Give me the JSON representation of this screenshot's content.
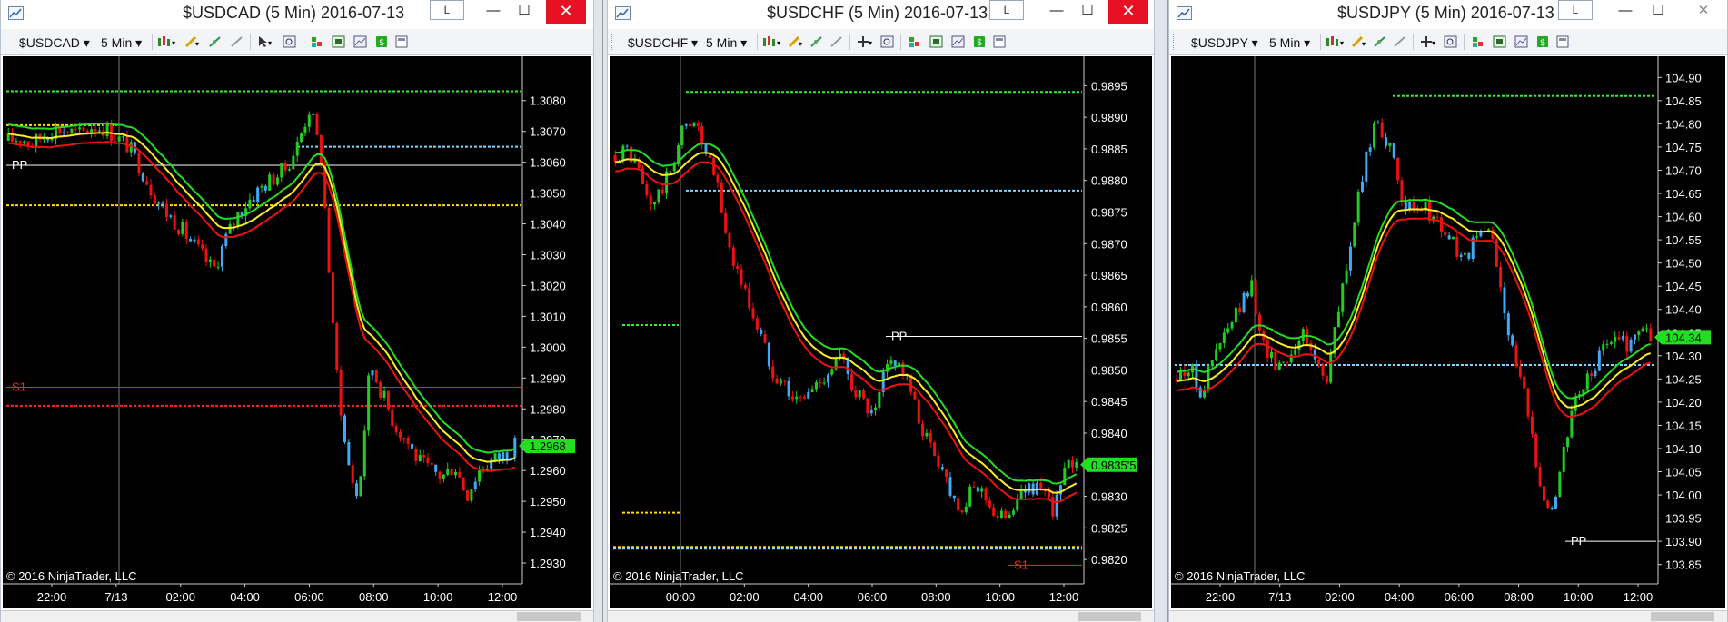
{
  "colors": {
    "background": "#000000",
    "up_candle": "#22cc22",
    "down_candle": "#ee1111",
    "neutral_candle": "#3fa9f5",
    "band_outer": "#22dd22",
    "band_mid": "#ffee22",
    "band_inner": "#ee1111",
    "level_pp": "#ffffff",
    "level_green": "#33ee33",
    "level_yellow": "#ffdd00",
    "level_cyan": "#7fd4ff",
    "level_red": "#ff2222",
    "price_label_bg": "#22dd22"
  },
  "windows": [
    {
      "title": "$USDCAD (5 Min)  2016-07-13",
      "tag": "L",
      "toolbar": {
        "instrument": "$USDCAD",
        "interval": "5 Min"
      },
      "copyright": "© 2016 NinjaTrader, LLC",
      "chart_data": {
        "type": "candlestick",
        "ylim": [
          1.2925,
          1.3092
        ],
        "y_ticks": [
          "1.3080",
          "1.3070",
          "1.3060",
          "1.3050",
          "1.3040",
          "1.3030",
          "1.3020",
          "1.3010",
          "1.3000",
          "1.2990",
          "1.2980",
          "1.2970",
          "1.2960",
          "1.2950",
          "1.2940",
          "1.2930"
        ],
        "x_ticks": [
          "22:00",
          "7/13",
          "02:00",
          "04:00",
          "06:00",
          "08:00",
          "10:00",
          "12:00"
        ],
        "last_price": "1.2968",
        "levels": [
          {
            "label": "PP",
            "value": 1.3059,
            "color": "level_pp"
          },
          {
            "label": "S1",
            "value": 1.2987,
            "color": "level_red"
          },
          {
            "label": "",
            "value": 1.3083,
            "color": "level_green"
          },
          {
            "label": "",
            "value": 1.3072,
            "color": "level_yellow"
          },
          {
            "label": "",
            "value": 1.3065,
            "color": "level_cyan"
          },
          {
            "label": "",
            "value": 1.3046,
            "color": "level_yellow"
          },
          {
            "label": "",
            "value": 1.2981,
            "color": "level_red"
          }
        ],
        "path": [
          1.3067,
          1.3068,
          1.3066,
          1.3069,
          1.3071,
          1.307,
          1.3069,
          1.3072,
          1.3071,
          1.3068,
          1.3065,
          1.3058,
          1.305,
          1.3044,
          1.304,
          1.3035,
          1.303,
          1.3025,
          1.3035,
          1.3043,
          1.3048,
          1.3052,
          1.3055,
          1.3058,
          1.3066,
          1.3078,
          1.306,
          1.3,
          1.2965,
          1.295,
          1.2995,
          1.2985,
          1.2975,
          1.297,
          1.2963,
          1.296,
          1.2958,
          1.2962,
          1.2952,
          1.296,
          1.2963,
          1.2965,
          1.2968
        ]
      }
    },
    {
      "title": "$USDCHF (5 Min)  2016-07-13",
      "tag": "L",
      "toolbar": {
        "instrument": "$USDCHF",
        "interval": "5 Min"
      },
      "copyright": "© 2016 NinjaTrader, LLC",
      "chart_data": {
        "type": "candlestick",
        "ylim": [
          0.9817,
          0.98985
        ],
        "y_ticks": [
          "0.9895",
          "0.9890",
          "0.9885",
          "0.9880",
          "0.9875",
          "0.9870",
          "0.9865",
          "0.9860",
          "0.9855",
          "0.9850",
          "0.9845",
          "0.9840",
          "0.9835",
          "0.9830",
          "0.9825",
          "0.9820"
        ],
        "x_ticks": [
          "00:00",
          "02:00",
          "04:00",
          "06:00",
          "08:00",
          "10:00",
          "12:00"
        ],
        "last_price": "0.9835'5",
        "levels": [
          {
            "label": "PP",
            "value": 0.98553,
            "color": "level_pp"
          },
          {
            "label": "S1",
            "value": 0.98191,
            "color": "level_red"
          },
          {
            "label": "",
            "value": 0.9894,
            "color": "level_green"
          },
          {
            "label": "",
            "value": 0.98784,
            "color": "level_cyan"
          },
          {
            "label": "",
            "value": 0.98571,
            "color": "level_green"
          },
          {
            "label": "",
            "value": 0.98274,
            "color": "level_yellow"
          },
          {
            "label": "",
            "value": 0.9822,
            "color": "level_yellow"
          },
          {
            "label": "",
            "value": 0.98217,
            "color": "level_cyan"
          }
        ],
        "path": [
          0.9884,
          0.9885,
          0.9882,
          0.9876,
          0.9878,
          0.9882,
          0.9888,
          0.989,
          0.9884,
          0.988,
          0.987,
          0.9865,
          0.986,
          0.9855,
          0.985,
          0.9848,
          0.9845,
          0.9846,
          0.9848,
          0.985,
          0.9852,
          0.9848,
          0.9845,
          0.9842,
          0.985,
          0.9852,
          0.9848,
          0.9842,
          0.9838,
          0.9835,
          0.983,
          0.9828,
          0.9832,
          0.983,
          0.9826,
          0.9828,
          0.983,
          0.9832,
          0.983,
          0.9828,
          0.9834,
          0.9836
        ]
      }
    },
    {
      "title": "$USDJPY (5 Min)  2016-07-13",
      "tag": "L",
      "toolbar": {
        "instrument": "$USDJPY",
        "interval": "5 Min"
      },
      "copyright": "© 2016 NinjaTrader, LLC",
      "chart_data": {
        "type": "candlestick",
        "ylim": [
          103.82,
          104.93
        ],
        "y_ticks": [
          "104.90",
          "104.85",
          "104.80",
          "104.75",
          "104.70",
          "104.65",
          "104.60",
          "104.55",
          "104.50",
          "104.45",
          "104.40",
          "104.35",
          "104.30",
          "104.25",
          "104.20",
          "104.15",
          "104.10",
          "104.05",
          "104.00",
          "103.95",
          "103.90",
          "103.85"
        ],
        "x_ticks": [
          "22:00",
          "7/13",
          "02:00",
          "04:00",
          "06:00",
          "08:00",
          "10:00",
          "12:00"
        ],
        "last_price": "104.34",
        "levels": [
          {
            "label": "PP",
            "value": 103.9,
            "color": "level_pp"
          },
          {
            "label": "",
            "value": 104.86,
            "color": "level_green"
          },
          {
            "label": "",
            "value": 104.28,
            "color": "level_cyan"
          }
        ],
        "path": [
          104.25,
          104.28,
          104.22,
          104.3,
          104.35,
          104.4,
          104.45,
          104.32,
          104.28,
          104.3,
          104.35,
          104.3,
          104.25,
          104.4,
          104.55,
          104.7,
          104.82,
          104.75,
          104.65,
          104.6,
          104.62,
          104.58,
          104.55,
          104.5,
          104.55,
          104.58,
          104.45,
          104.3,
          104.2,
          104.05,
          103.95,
          104.1,
          104.2,
          104.25,
          104.3,
          104.35,
          104.32,
          104.36,
          104.34
        ]
      }
    }
  ]
}
